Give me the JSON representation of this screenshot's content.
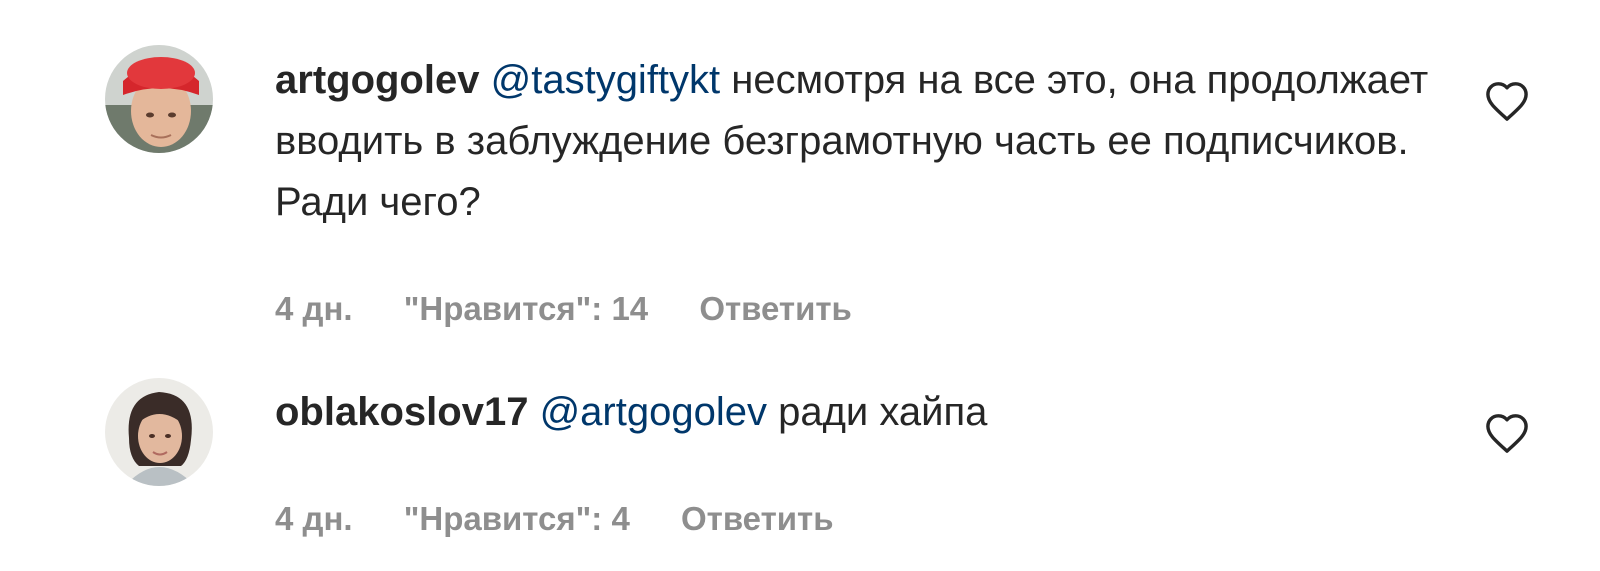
{
  "comments": [
    {
      "username": "artgogolev",
      "mention": "@tastygiftykt",
      "text": "несмотря на все это, она продолжает вводить в заблуждение безграмотную часть ее подписчиков. Ради чего?",
      "time": "4 дн.",
      "likes": "\"Нравится\": 14",
      "reply": "Ответить",
      "like_icon": "heart-outline-icon"
    },
    {
      "username": "oblakoslov17",
      "mention": "@artgogolev",
      "text": "ради хайпа",
      "time": "4 дн.",
      "likes": "\"Нравится\": 4",
      "reply": "Ответить",
      "like_icon": "heart-outline-icon"
    }
  ],
  "colors": {
    "text": "#262626",
    "mention": "#00376b",
    "meta": "#8e8e8e"
  }
}
